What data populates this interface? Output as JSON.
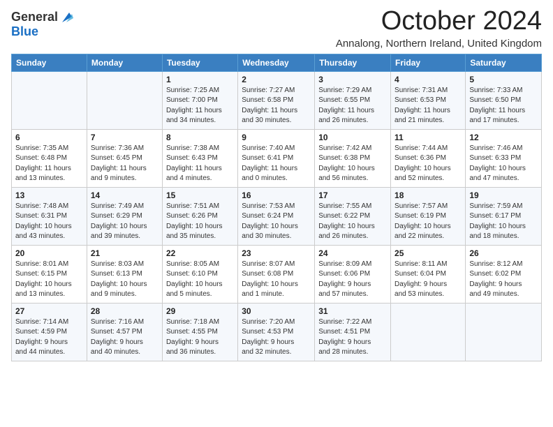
{
  "header": {
    "logo_general": "General",
    "logo_blue": "Blue",
    "month_title": "October 2024",
    "location": "Annalong, Northern Ireland, United Kingdom"
  },
  "days_of_week": [
    "Sunday",
    "Monday",
    "Tuesday",
    "Wednesday",
    "Thursday",
    "Friday",
    "Saturday"
  ],
  "weeks": [
    [
      {
        "day": "",
        "info": ""
      },
      {
        "day": "",
        "info": ""
      },
      {
        "day": "1",
        "info": "Sunrise: 7:25 AM\nSunset: 7:00 PM\nDaylight: 11 hours\nand 34 minutes."
      },
      {
        "day": "2",
        "info": "Sunrise: 7:27 AM\nSunset: 6:58 PM\nDaylight: 11 hours\nand 30 minutes."
      },
      {
        "day": "3",
        "info": "Sunrise: 7:29 AM\nSunset: 6:55 PM\nDaylight: 11 hours\nand 26 minutes."
      },
      {
        "day": "4",
        "info": "Sunrise: 7:31 AM\nSunset: 6:53 PM\nDaylight: 11 hours\nand 21 minutes."
      },
      {
        "day": "5",
        "info": "Sunrise: 7:33 AM\nSunset: 6:50 PM\nDaylight: 11 hours\nand 17 minutes."
      }
    ],
    [
      {
        "day": "6",
        "info": "Sunrise: 7:35 AM\nSunset: 6:48 PM\nDaylight: 11 hours\nand 13 minutes."
      },
      {
        "day": "7",
        "info": "Sunrise: 7:36 AM\nSunset: 6:45 PM\nDaylight: 11 hours\nand 9 minutes."
      },
      {
        "day": "8",
        "info": "Sunrise: 7:38 AM\nSunset: 6:43 PM\nDaylight: 11 hours\nand 4 minutes."
      },
      {
        "day": "9",
        "info": "Sunrise: 7:40 AM\nSunset: 6:41 PM\nDaylight: 11 hours\nand 0 minutes."
      },
      {
        "day": "10",
        "info": "Sunrise: 7:42 AM\nSunset: 6:38 PM\nDaylight: 10 hours\nand 56 minutes."
      },
      {
        "day": "11",
        "info": "Sunrise: 7:44 AM\nSunset: 6:36 PM\nDaylight: 10 hours\nand 52 minutes."
      },
      {
        "day": "12",
        "info": "Sunrise: 7:46 AM\nSunset: 6:33 PM\nDaylight: 10 hours\nand 47 minutes."
      }
    ],
    [
      {
        "day": "13",
        "info": "Sunrise: 7:48 AM\nSunset: 6:31 PM\nDaylight: 10 hours\nand 43 minutes."
      },
      {
        "day": "14",
        "info": "Sunrise: 7:49 AM\nSunset: 6:29 PM\nDaylight: 10 hours\nand 39 minutes."
      },
      {
        "day": "15",
        "info": "Sunrise: 7:51 AM\nSunset: 6:26 PM\nDaylight: 10 hours\nand 35 minutes."
      },
      {
        "day": "16",
        "info": "Sunrise: 7:53 AM\nSunset: 6:24 PM\nDaylight: 10 hours\nand 30 minutes."
      },
      {
        "day": "17",
        "info": "Sunrise: 7:55 AM\nSunset: 6:22 PM\nDaylight: 10 hours\nand 26 minutes."
      },
      {
        "day": "18",
        "info": "Sunrise: 7:57 AM\nSunset: 6:19 PM\nDaylight: 10 hours\nand 22 minutes."
      },
      {
        "day": "19",
        "info": "Sunrise: 7:59 AM\nSunset: 6:17 PM\nDaylight: 10 hours\nand 18 minutes."
      }
    ],
    [
      {
        "day": "20",
        "info": "Sunrise: 8:01 AM\nSunset: 6:15 PM\nDaylight: 10 hours\nand 13 minutes."
      },
      {
        "day": "21",
        "info": "Sunrise: 8:03 AM\nSunset: 6:13 PM\nDaylight: 10 hours\nand 9 minutes."
      },
      {
        "day": "22",
        "info": "Sunrise: 8:05 AM\nSunset: 6:10 PM\nDaylight: 10 hours\nand 5 minutes."
      },
      {
        "day": "23",
        "info": "Sunrise: 8:07 AM\nSunset: 6:08 PM\nDaylight: 10 hours\nand 1 minute."
      },
      {
        "day": "24",
        "info": "Sunrise: 8:09 AM\nSunset: 6:06 PM\nDaylight: 9 hours\nand 57 minutes."
      },
      {
        "day": "25",
        "info": "Sunrise: 8:11 AM\nSunset: 6:04 PM\nDaylight: 9 hours\nand 53 minutes."
      },
      {
        "day": "26",
        "info": "Sunrise: 8:12 AM\nSunset: 6:02 PM\nDaylight: 9 hours\nand 49 minutes."
      }
    ],
    [
      {
        "day": "27",
        "info": "Sunrise: 7:14 AM\nSunset: 4:59 PM\nDaylight: 9 hours\nand 44 minutes."
      },
      {
        "day": "28",
        "info": "Sunrise: 7:16 AM\nSunset: 4:57 PM\nDaylight: 9 hours\nand 40 minutes."
      },
      {
        "day": "29",
        "info": "Sunrise: 7:18 AM\nSunset: 4:55 PM\nDaylight: 9 hours\nand 36 minutes."
      },
      {
        "day": "30",
        "info": "Sunrise: 7:20 AM\nSunset: 4:53 PM\nDaylight: 9 hours\nand 32 minutes."
      },
      {
        "day": "31",
        "info": "Sunrise: 7:22 AM\nSunset: 4:51 PM\nDaylight: 9 hours\nand 28 minutes."
      },
      {
        "day": "",
        "info": ""
      },
      {
        "day": "",
        "info": ""
      }
    ]
  ]
}
